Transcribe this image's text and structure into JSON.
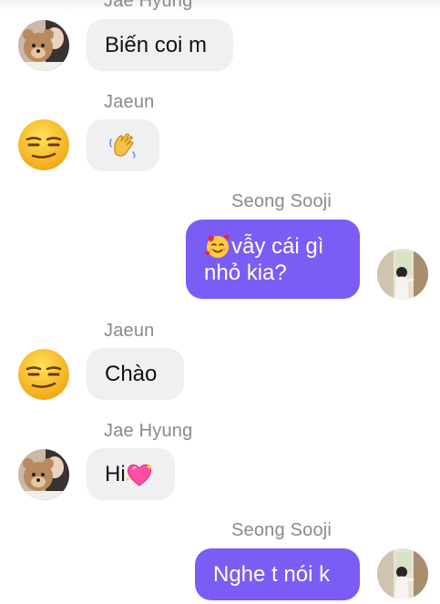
{
  "messages": [
    {
      "sender": "Jae Hyung",
      "text": "Biến coi m",
      "avatar": "teddy-bear-photo-avatar"
    },
    {
      "sender": "Jaeun",
      "emoji": "waving-hand-icon",
      "avatar": "smirk-emoji-avatar"
    },
    {
      "sender": "Seong Sooji",
      "emoji": "smiling-face-with-hearts-icon",
      "line1": "vẫy cái gì",
      "line2": "nhỏ kia?",
      "avatar": "window-girl-photo-avatar"
    },
    {
      "sender": "Jaeun",
      "text": "Chào",
      "avatar": "smirk-emoji-avatar"
    },
    {
      "sender": "Jae Hyung",
      "text": "Hi",
      "emoji": "sparkling-heart-icon",
      "avatar": "teddy-bear-photo-avatar"
    },
    {
      "sender": "Seong Sooji",
      "text": "Nghe t nói k",
      "avatar": "window-girl-photo-avatar"
    }
  ],
  "colors": {
    "outgoing_bubble": "#7b5cf5",
    "incoming_bubble": "#f0f0f2",
    "sender_name": "#8a8a8e"
  }
}
